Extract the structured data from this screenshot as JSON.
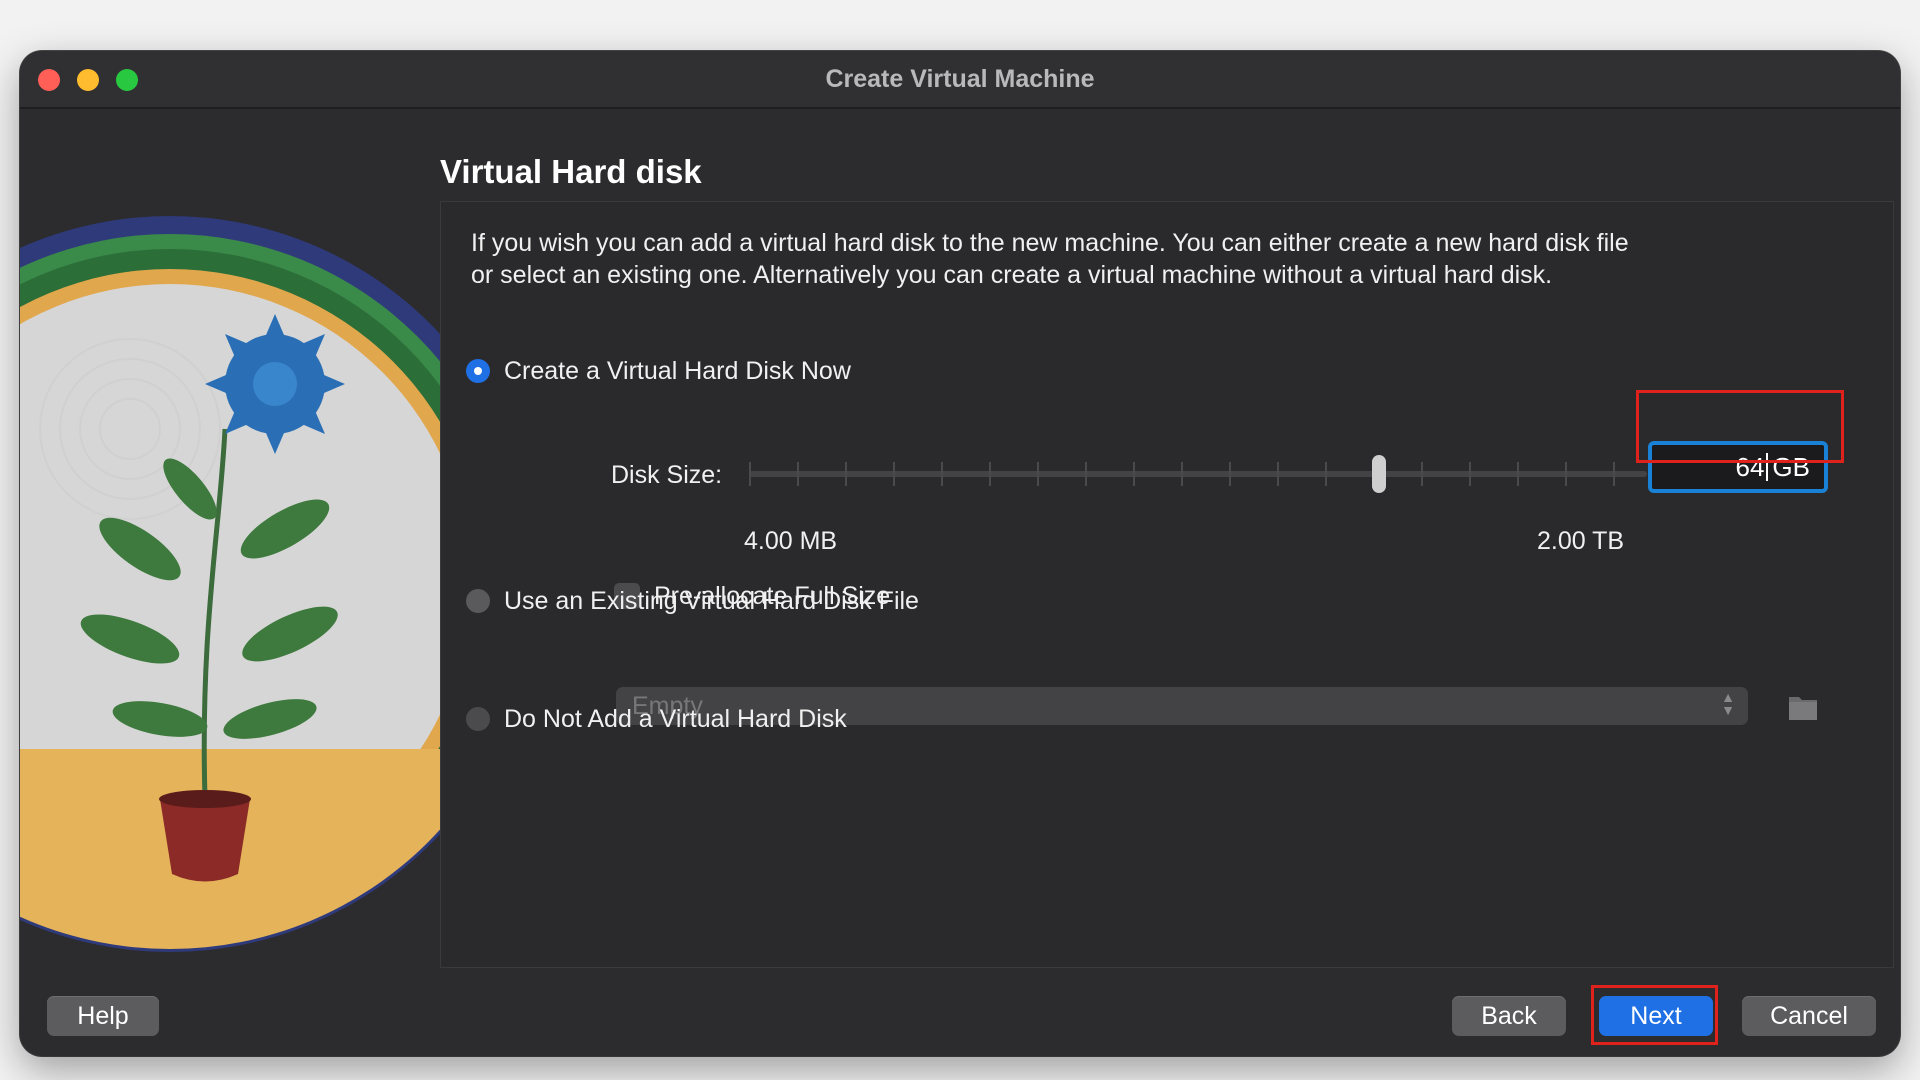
{
  "window": {
    "title": "Create Virtual Machine"
  },
  "page": {
    "title": "Virtual Hard disk",
    "description": "If you wish you can add a virtual hard disk to the new machine. You can either create a new hard disk file or select an existing one. Alternatively you can create a virtual machine without a virtual hard disk."
  },
  "options": {
    "create_new": {
      "label": "Create a Virtual Hard Disk Now",
      "selected": true
    },
    "use_existing": {
      "label": "Use an Existing Virtual Hard Disk File",
      "selected": false
    },
    "none": {
      "label": "Do Not Add a Virtual Hard Disk",
      "selected": false
    }
  },
  "disk_size": {
    "label": "Disk Size:",
    "min_label": "4.00 MB",
    "max_label": "2.00 TB",
    "value": "64",
    "unit": "GB",
    "slider_position": 0.74
  },
  "preallocate": {
    "label": "Pre-allocate Full Size",
    "checked": false
  },
  "existing_file": {
    "selected": "Empty"
  },
  "buttons": {
    "help": "Help",
    "back": "Back",
    "next": "Next",
    "cancel": "Cancel"
  },
  "colors": {
    "window_bg": "#2c2c2e",
    "accent": "#1f6fe5",
    "focus_ring": "#1a82d6",
    "annotation": "#e0221c"
  },
  "icons": [
    "close-icon",
    "minimize-icon",
    "maximize-icon",
    "plant-illustration",
    "folder-icon",
    "chevron-updown-icon"
  ]
}
